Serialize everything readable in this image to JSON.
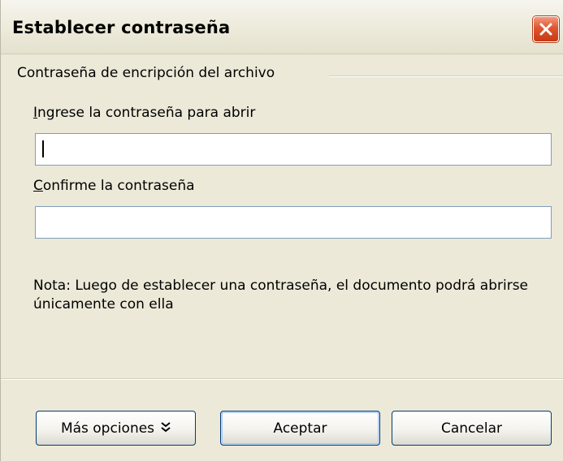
{
  "window": {
    "title": "Establecer contraseña",
    "close_icon": "close-icon",
    "accent_close": "#e0542f"
  },
  "group": {
    "label": "Contraseña de encripción del archivo"
  },
  "fields": [
    {
      "mnemonic": "I",
      "label_rest": "ngrese la contraseña para abrir",
      "value": ""
    },
    {
      "mnemonic": "C",
      "label_rest": "onfirme la contraseña",
      "value": ""
    }
  ],
  "note": "Nota: Luego de establecer una contraseña, el documento podrá abrirse únicamente con ella",
  "buttons": {
    "more_options": "Más opciones",
    "more_options_icon": "double-chevron-down-icon",
    "accept": "Aceptar",
    "cancel": "Cancelar"
  }
}
